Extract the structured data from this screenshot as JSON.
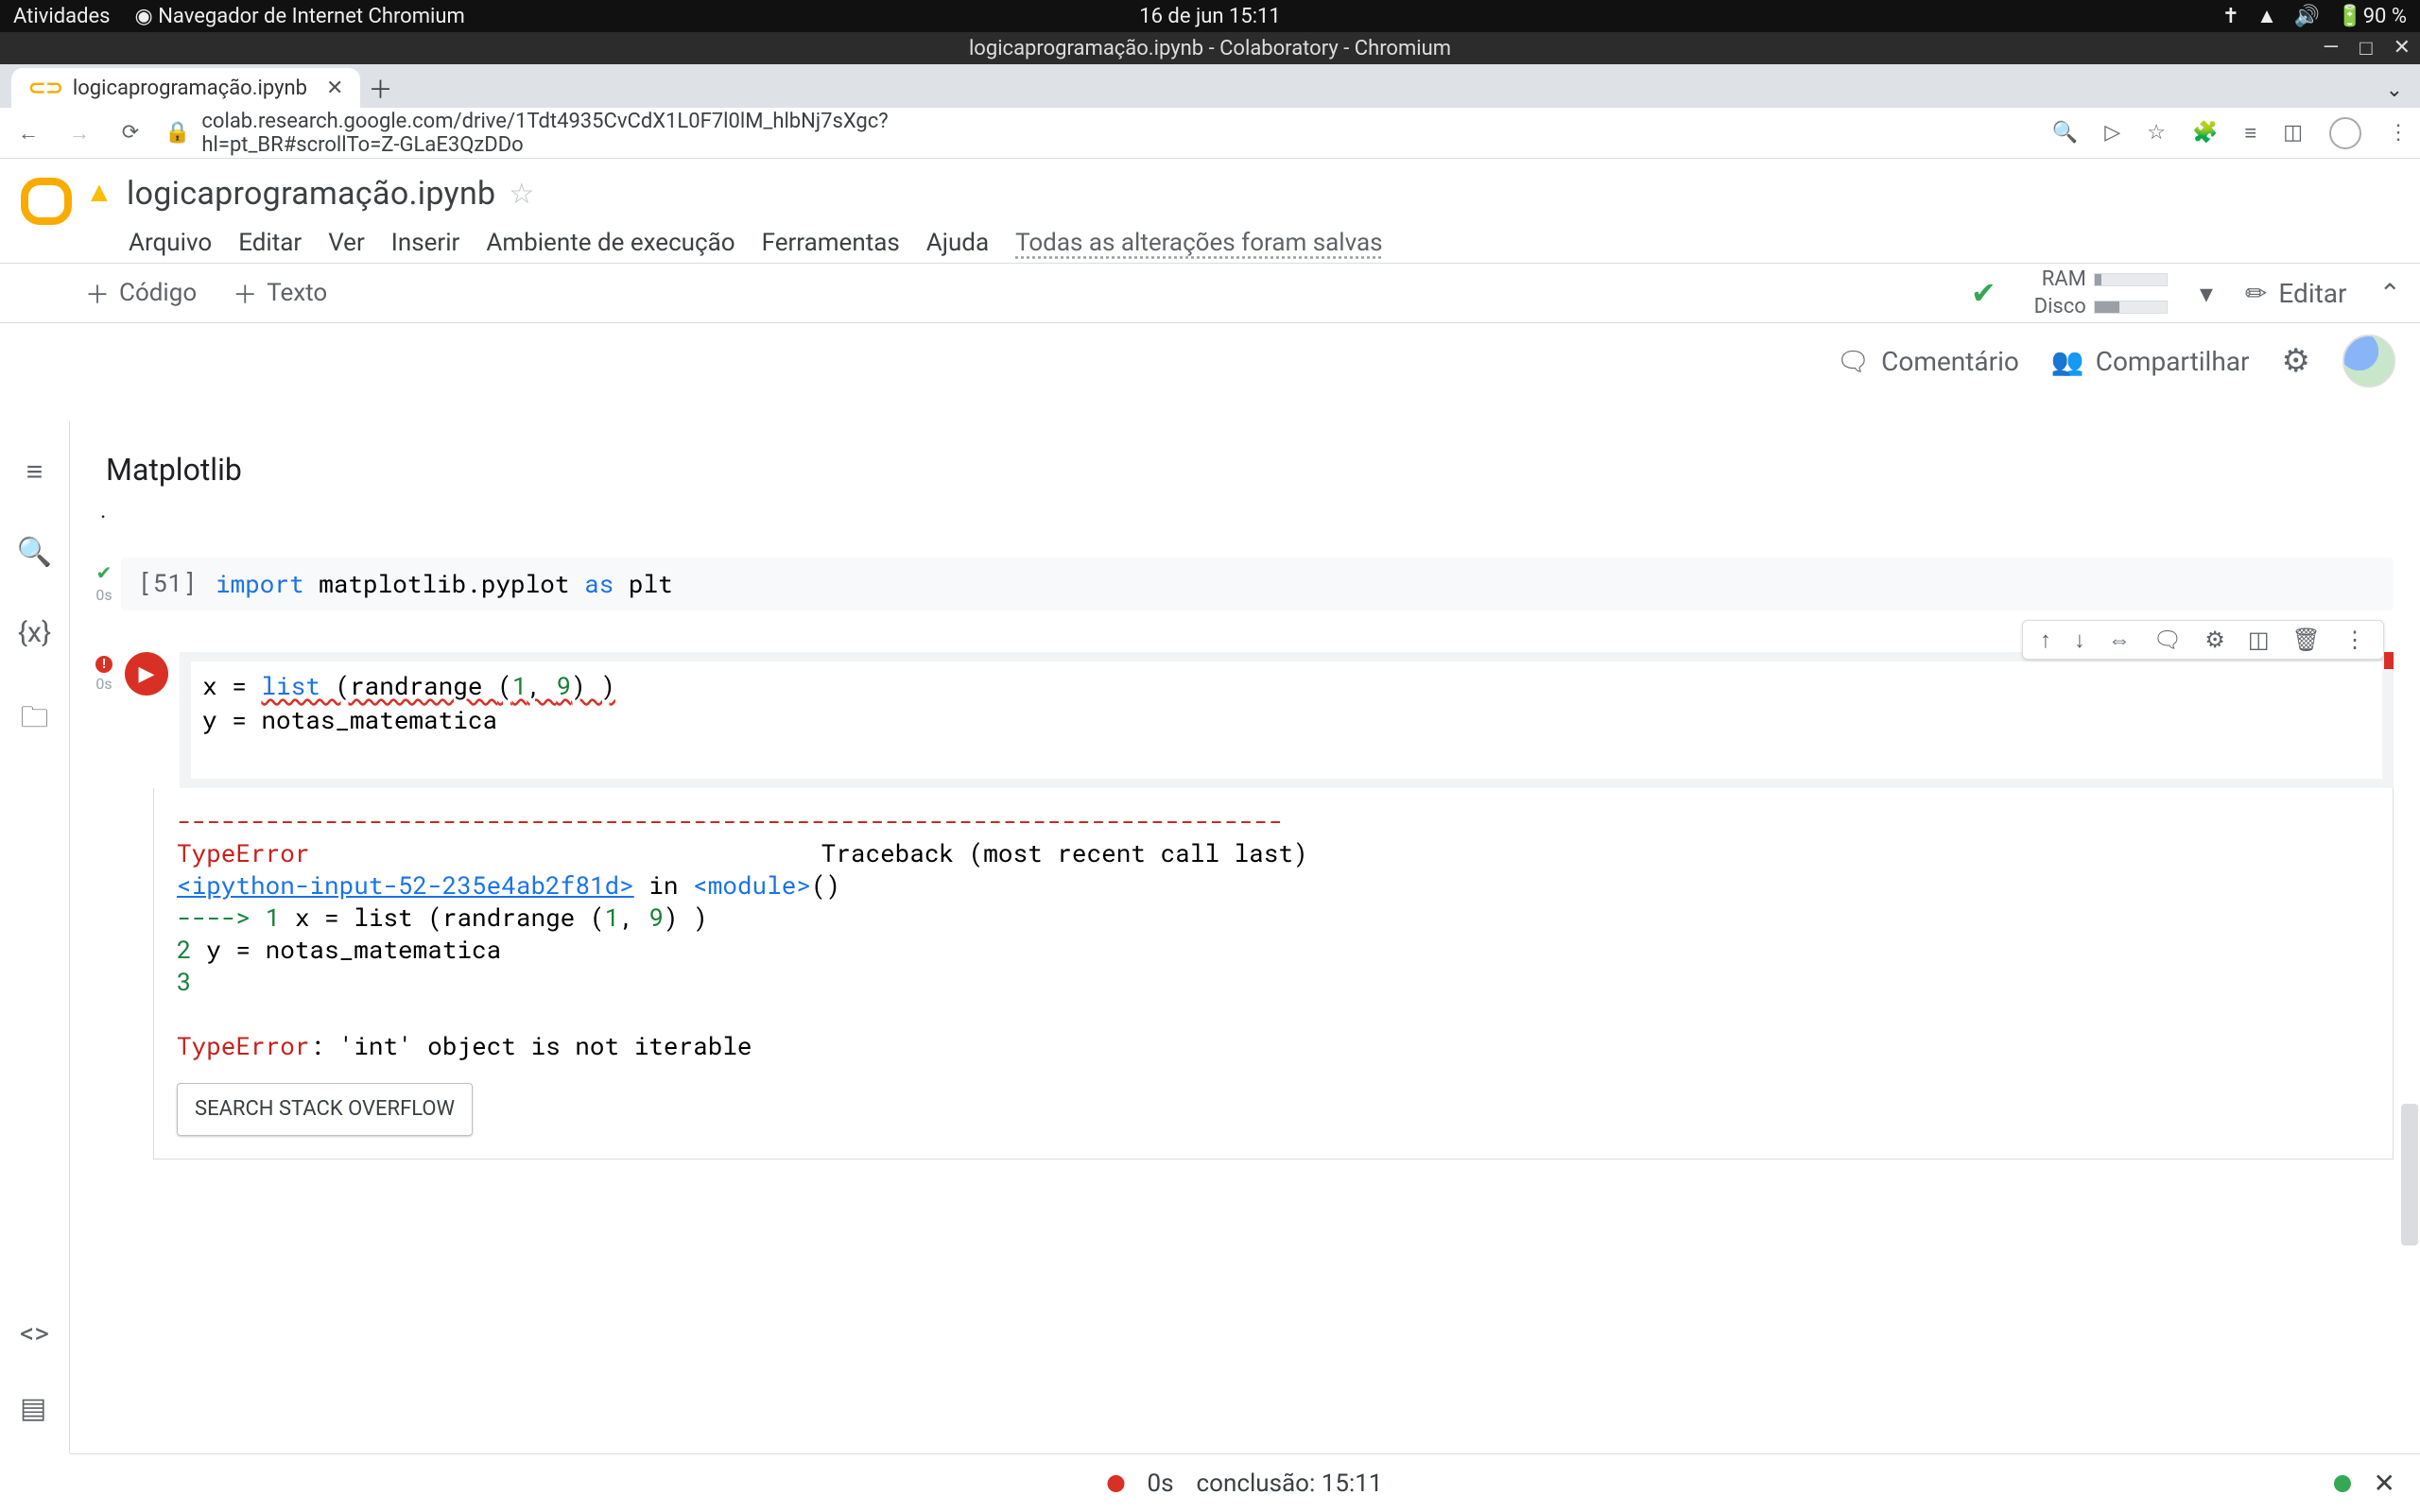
{
  "gnome": {
    "atividades": "Atividades",
    "app_label": "Navegador de Internet Chromium",
    "datetime": "16 de jun  15:11",
    "battery": "90 %"
  },
  "chrome": {
    "title": "logicaprogramação.ipynb - Colaboratory - Chromium",
    "tab_label": "logicaprogramação.ipynb",
    "url": "colab.research.google.com/drive/1Tdt4935CvCdX1L0F7l0lM_hlbNj7sXgc?hl=pt_BR#scrollTo=Z-GLaE3QzDDo"
  },
  "colab": {
    "doc_title": "logicaprogramação.ipynb",
    "menu": {
      "arquivo": "Arquivo",
      "editar": "Editar",
      "ver": "Ver",
      "inserir": "Inserir",
      "ambiente": "Ambiente de execução",
      "ferramentas": "Ferramentas",
      "ajuda": "Ajuda",
      "saved": "Todas as alterações foram salvas"
    },
    "header_buttons": {
      "comentario": "Comentário",
      "compartilhar": "Compartilhar"
    },
    "toolbar": {
      "codigo": "Código",
      "texto": "Texto",
      "ram_label": "RAM",
      "disco_label": "Disco",
      "editar": "Editar"
    },
    "section": "Matplotlib",
    "cell1": {
      "prompt": "[51]",
      "kw_import": "import",
      "mod": " matplotlib.pyplot ",
      "kw_as": "as",
      "alias": " plt",
      "duration": "0s"
    },
    "cell2": {
      "duration": "0s",
      "line1_pre": "x = ",
      "line1_list": "list ",
      "line1_rand": "(randrange ",
      "line1_args_open": "(",
      "line1_arg1": "1",
      "line1_comma": ", ",
      "line1_arg2": "9",
      "line1_close": ") )",
      "line2": "y = notas_matematica"
    },
    "output": {
      "dashes": "---------------------------------------------------------------------------",
      "error_name": "TypeError",
      "traceback_label": "Traceback (most recent call last)",
      "frame_link": "<ipython-input-52-235e4ab2f81d>",
      "in_label": " in ",
      "module_label": "<module>",
      "parens": "()",
      "arrow": "----> 1",
      "l1": " x = list (randrange (",
      "l1_a": "1",
      "l1_c": ", ",
      "l1_b": "9",
      "l1_end": ") )",
      "l2_num": "      2",
      "l2": " y = notas_matematica",
      "l3_num": "      3",
      "final_name": "TypeError",
      "final_msg": ": 'int' object is not iterable",
      "so_button": "SEARCH STACK OVERFLOW"
    },
    "status": {
      "duration": "0s",
      "completion": "conclusão: 15:11"
    }
  }
}
